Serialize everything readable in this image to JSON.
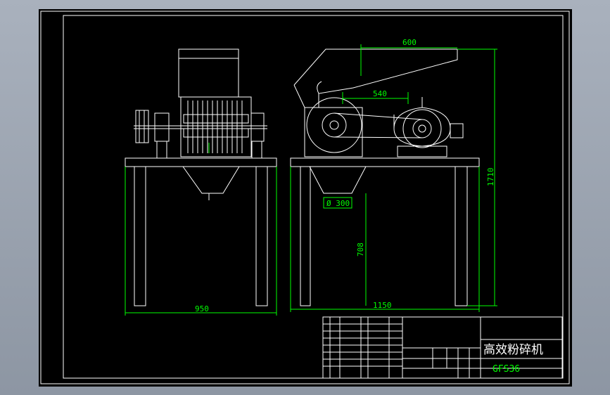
{
  "drawing": {
    "dimensions": {
      "overall_width_front": "600",
      "frame_width": "540",
      "outlet_diameter": "Ø 300",
      "table_height": "708",
      "overall_height": "1710",
      "side_width": "950",
      "front_width": "1150"
    },
    "title_block": {
      "product_name": "高效粉碎机",
      "model": "GFS36"
    },
    "colors": {
      "outline": "#ffffff",
      "dimension": "#00ff00",
      "background": "#000000"
    }
  }
}
